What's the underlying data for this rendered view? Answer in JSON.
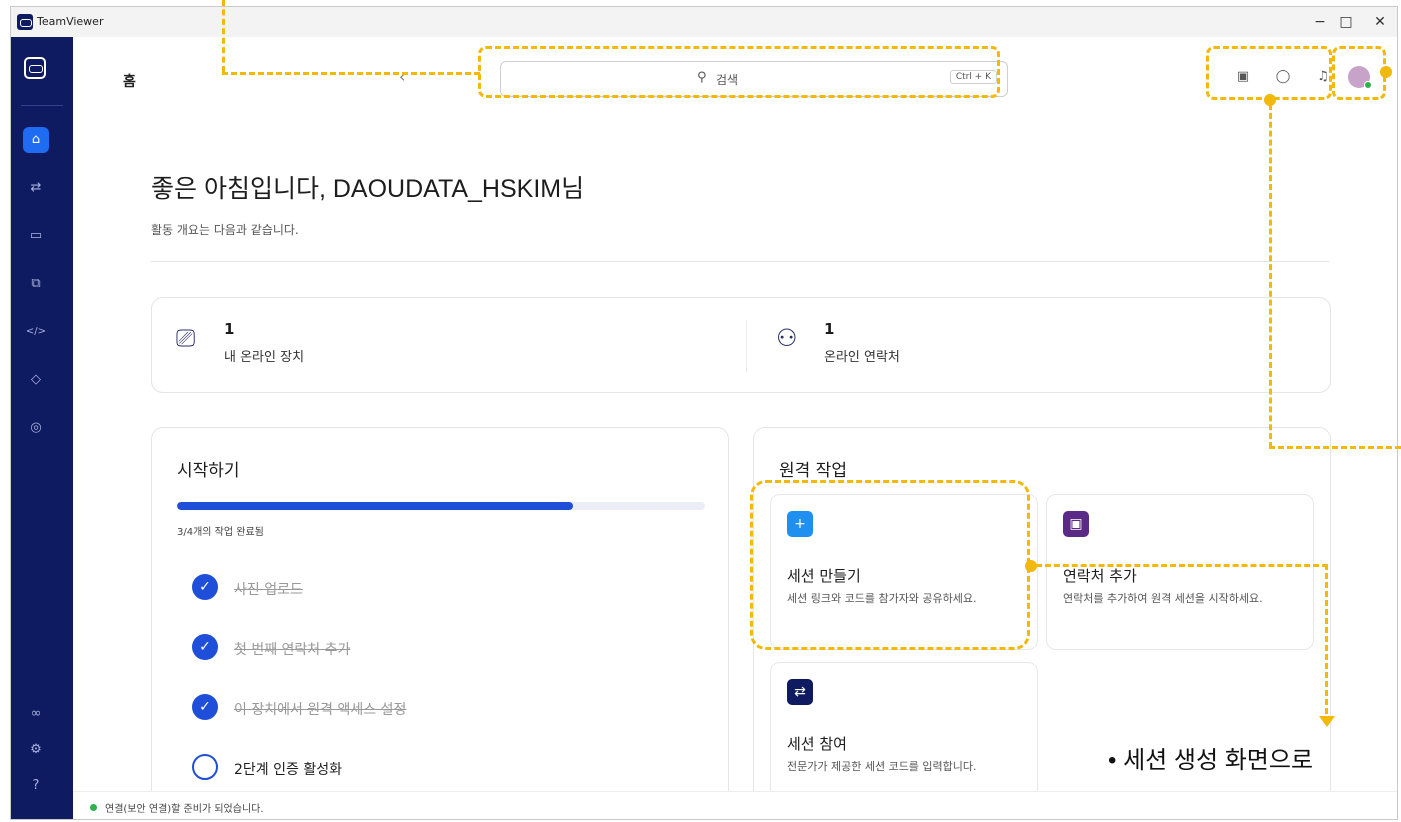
{
  "app": {
    "title": "TeamViewer"
  },
  "window_controls": {
    "minimize": "−",
    "maximize": "□",
    "close": "✕"
  },
  "sidebar": {
    "items": [
      {
        "name": "home",
        "icon": "home-icon",
        "glyph": "⌂",
        "active": true
      },
      {
        "name": "connect",
        "icon": "swap-arrows-icon",
        "glyph": "⇄",
        "active": false
      },
      {
        "name": "devices",
        "icon": "monitor-icon",
        "glyph": "▭",
        "active": false
      },
      {
        "name": "remote",
        "icon": "window-icon",
        "glyph": "⧉",
        "active": false
      },
      {
        "name": "developer",
        "icon": "code-icon",
        "glyph": "</>",
        "active": false
      },
      {
        "name": "tags",
        "icon": "tag-icon",
        "glyph": "◇",
        "active": false
      },
      {
        "name": "security",
        "icon": "shield-icon",
        "glyph": "◎",
        "active": false
      }
    ],
    "bottom_items": [
      {
        "name": "integrations",
        "icon": "link-icon",
        "glyph": "∞"
      },
      {
        "name": "settings",
        "icon": "gear-icon",
        "glyph": "⚙"
      },
      {
        "name": "help",
        "icon": "help-icon",
        "glyph": "?"
      }
    ]
  },
  "header": {
    "page_title": "홈",
    "back_glyph": "‹",
    "search_placeholder": "검색",
    "search_shortcut": "Ctrl + K"
  },
  "greeting": {
    "title": "좋은 아침입니다, DAOUDATA_HSKIM님",
    "subtitle": "활동 개요는 다음과 같습니다."
  },
  "stats": [
    {
      "value": "1",
      "label": "내 온라인 장치",
      "icon": "devices-icon"
    },
    {
      "value": "1",
      "label": "온라인 연락처",
      "icon": "contact-check-icon"
    }
  ],
  "getting_started": {
    "title": "시작하기",
    "progress_fraction": 0.75,
    "progress_text": "3/4개의 작업 완료됨",
    "tasks": [
      {
        "label": "사진 업로드",
        "done": true
      },
      {
        "label": "첫 번째 연락처 추가",
        "done": true
      },
      {
        "label": "이 장치에서 원격 액세스 설정",
        "done": true
      },
      {
        "label": "2단계 인증 활성화",
        "done": false
      }
    ]
  },
  "remote_work": {
    "title": "원격 작업",
    "actions": [
      {
        "title": "세션 만들기",
        "desc": "세션 링크와 코드를 참가자와 공유하세요.",
        "icon": "plus-icon",
        "glyph": "+",
        "color": "#1f8ff0"
      },
      {
        "title": "연락처 추가",
        "desc": "연락처를 추가하여 원격 세션을 시작하세요.",
        "icon": "contact-card-icon",
        "glyph": "▣",
        "color": "#5b2a86"
      },
      {
        "title": "세션 참여",
        "desc": "전문가가 제공한 세션 코드를 입력합니다.",
        "icon": "join-arrows-icon",
        "glyph": "⇄",
        "color": "#0e1b60"
      }
    ]
  },
  "status": {
    "text": "연결(보안 연결)할 준비가 되었습니다."
  },
  "annotation": {
    "caption": "•  세션 생성 화면으로",
    "accent": "#f2b80a"
  }
}
